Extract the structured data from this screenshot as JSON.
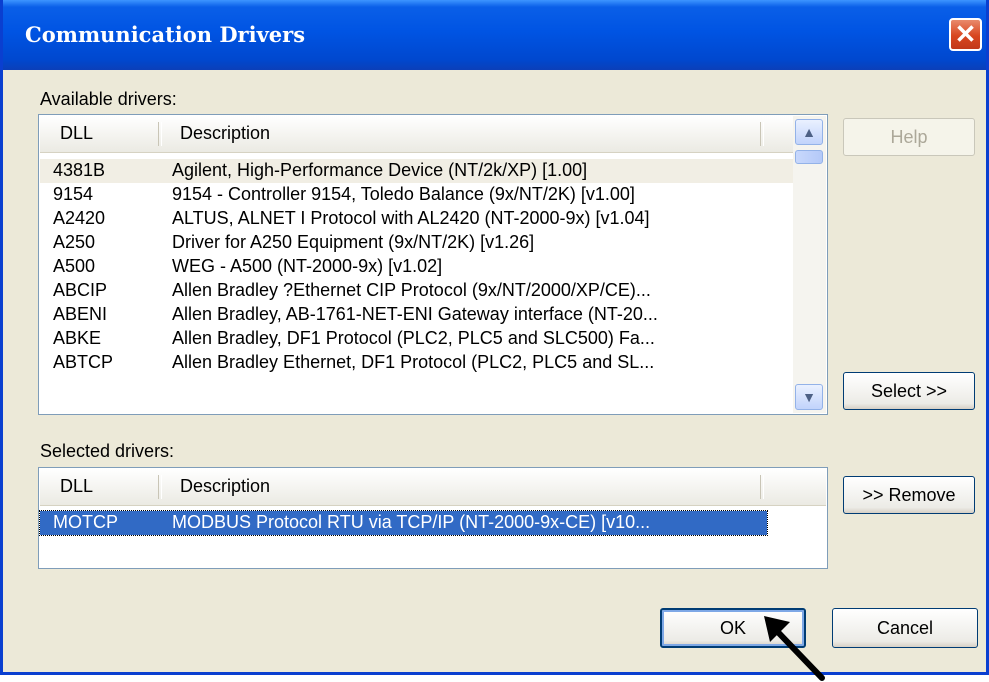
{
  "window": {
    "title": "Communication Drivers",
    "close_glyph": "✕"
  },
  "available": {
    "label": "Available drivers:",
    "columns": [
      "DLL",
      "Description"
    ],
    "rows": [
      {
        "dll": "4381B",
        "desc": "Agilent, High-Performance Device (NT/2k/XP) [1.00]"
      },
      {
        "dll": "9154",
        "desc": "9154 - Controller 9154, Toledo Balance (9x/NT/2K) [v1.00]"
      },
      {
        "dll": "A2420",
        "desc": "ALTUS, ALNET I Protocol with AL2420 (NT-2000-9x) [v1.04]"
      },
      {
        "dll": "A250",
        "desc": "Driver for A250 Equipment (9x/NT/2K) [v1.26]"
      },
      {
        "dll": "A500",
        "desc": "WEG - A500 (NT-2000-9x) [v1.02]"
      },
      {
        "dll": "ABCIP",
        "desc": "Allen Bradley ?Ethernet CIP Protocol (9x/NT/2000/XP/CE)..."
      },
      {
        "dll": "ABENI",
        "desc": "Allen Bradley, AB-1761-NET-ENI Gateway interface (NT-20..."
      },
      {
        "dll": "ABKE",
        "desc": "Allen Bradley, DF1 Protocol (PLC2, PLC5 and SLC500) Fa..."
      },
      {
        "dll": "ABTCP",
        "desc": "Allen Bradley Ethernet, DF1 Protocol (PLC2, PLC5 and SL..."
      }
    ]
  },
  "selected": {
    "label": "Selected drivers:",
    "columns": [
      "DLL",
      "Description"
    ],
    "rows": [
      {
        "dll": "MOTCP",
        "desc": "MODBUS Protocol RTU via TCP/IP (NT-2000-9x-CE) [v10..."
      }
    ]
  },
  "buttons": {
    "help": "Help",
    "select": "Select >>",
    "remove": ">> Remove",
    "ok": "OK",
    "cancel": "Cancel"
  },
  "icons": {
    "scroll_up": "chevron-up-icon",
    "scroll_down": "chevron-down-icon",
    "pointer": "arrow-pointer-icon"
  },
  "colors": {
    "titlebar": "#0054e3",
    "selection": "#316ac5",
    "close": "#d8461f"
  }
}
